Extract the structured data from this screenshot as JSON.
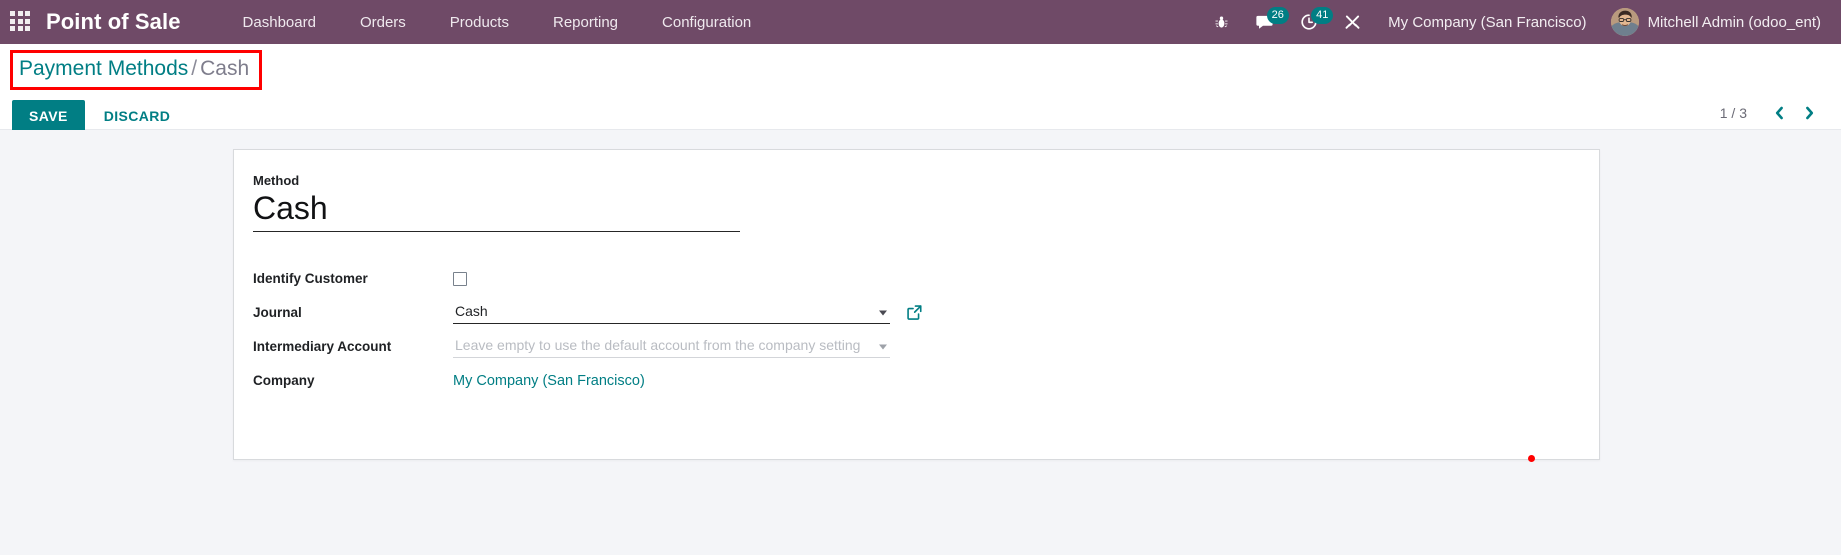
{
  "navbar": {
    "apps_icon": "apps-grid-icon",
    "brand": "Point of Sale",
    "menu": [
      {
        "label": "Dashboard"
      },
      {
        "label": "Orders"
      },
      {
        "label": "Products"
      },
      {
        "label": "Reporting"
      },
      {
        "label": "Configuration"
      }
    ],
    "systray": {
      "debug_icon": "bug-icon",
      "messages_icon": "chat-bubble-icon",
      "messages_count": "26",
      "activities_icon": "clock-icon",
      "activities_count": "41",
      "tools_icon": "wrench-icon",
      "company": "My Company (San Francisco)",
      "user": "Mitchell Admin (odoo_ent)",
      "avatar_icon": "user-avatar"
    }
  },
  "control_panel": {
    "breadcrumb": {
      "parent": "Payment Methods",
      "separator": "/",
      "current": "Cash"
    },
    "save_label": "SAVE",
    "discard_label": "DISCARD",
    "pager": {
      "count": "1 / 3",
      "prev_icon": "chevron-left-icon",
      "next_icon": "chevron-right-icon"
    },
    "highlight_color": "#ff0000"
  },
  "form": {
    "method": {
      "label": "Method",
      "value": "Cash"
    },
    "fields": [
      {
        "label": "Identify Customer",
        "type": "checkbox",
        "checked": false
      },
      {
        "label": "Journal",
        "type": "select",
        "value": "Cash",
        "placeholder": "",
        "has_external_link": true,
        "external_link_icon": "external-link-icon"
      },
      {
        "label": "Intermediary Account",
        "type": "select",
        "value": "",
        "placeholder": "Leave empty to use the default account from the company setting",
        "has_external_link": false
      },
      {
        "label": "Company",
        "type": "link",
        "value": "My Company (San Francisco)"
      }
    ]
  },
  "theme": {
    "navbar_bg": "#6f4a67",
    "accent": "#017e84",
    "page_bg": "#f4f5f8",
    "sheet_bg": "#ffffff"
  }
}
